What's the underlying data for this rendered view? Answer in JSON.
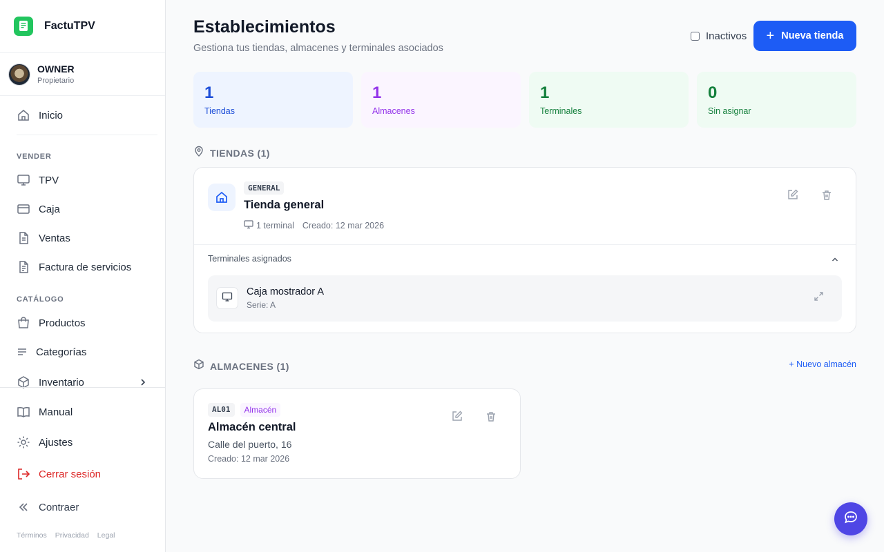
{
  "app": {
    "name": "FactuTPV",
    "logo_icon": "receipt-logo-icon",
    "brand_color": "#22c55e"
  },
  "user": {
    "name": "OWNER",
    "role": "Propietario"
  },
  "nav": {
    "home": "Inicio",
    "section_sell": "VENDER",
    "tpv": "TPV",
    "caja": "Caja",
    "ventas": "Ventas",
    "factura": "Factura de servicios",
    "section_catalog": "CATÁLOGO",
    "productos": "Productos",
    "categorias": "Categorías",
    "inventario": "Inventario",
    "manual": "Manual",
    "ajustes": "Ajustes",
    "logout": "Cerrar sesión",
    "collapse": "Contraer"
  },
  "footer": {
    "terms": "Términos",
    "privacy": "Privacidad",
    "legal": "Legal"
  },
  "header": {
    "title": "Establecimientos",
    "subtitle": "Gestiona tus tiendas, almacenes y terminales asociados",
    "inactive_label": "Inactivos",
    "new_store_label": "Nueva tienda",
    "accent": "#1d5cf5"
  },
  "stats": [
    {
      "value": "1",
      "label": "Tiendas",
      "bg": "#eef4ff",
      "color": "#1d4ed8"
    },
    {
      "value": "1",
      "label": "Almacenes",
      "bg": "#fbf5ff",
      "color": "#9333ea"
    },
    {
      "value": "1",
      "label": "Terminales",
      "bg": "#effbf3",
      "color": "#15803d"
    },
    {
      "value": "0",
      "label": "Sin asignar",
      "bg": "#effbf3",
      "color": "#15803d"
    }
  ],
  "stores_section": {
    "title": "TIENDAS (1)",
    "store": {
      "code": "GENERAL",
      "name": "Tienda general",
      "terminals": "1 terminal",
      "created": "Creado: 12 mar 2026",
      "assigned_title": "Terminales asignados",
      "terminal": {
        "name": "Caja mostrador A",
        "serie": "Serie: A"
      }
    }
  },
  "warehouses_section": {
    "title": "ALMACENES (1)",
    "new_label": "+ Nuevo almacén",
    "warehouse": {
      "code": "AL01",
      "type": "Almacén",
      "name": "Almacén central",
      "address": "Calle del puerto, 16",
      "created": "Creado: 12 mar 2026"
    }
  },
  "colors": {
    "logout": "#dc2626",
    "chat": "#4f46e5"
  }
}
